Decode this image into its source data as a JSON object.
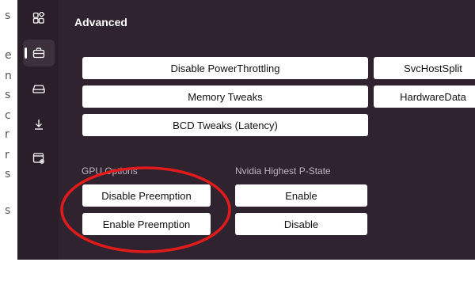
{
  "left_strip": {
    "chars": [
      "s",
      "e",
      "n",
      "s",
      "c",
      "r",
      "r",
      "s",
      "s"
    ]
  },
  "sidebar": {
    "items": [
      {
        "name": "grid-plus-icon"
      },
      {
        "name": "briefcase-icon",
        "active": true
      },
      {
        "name": "drive-icon"
      },
      {
        "name": "download-icon"
      },
      {
        "name": "window-settings-icon"
      }
    ]
  },
  "header": {
    "title": "Advanced"
  },
  "tweaks": {
    "col1": [
      "Disable PowerThrottling",
      "Memory Tweaks",
      "BCD Tweaks (Latency)"
    ],
    "col2": [
      "SvcHostSplit",
      "HardwareData"
    ]
  },
  "gpu": {
    "label": "GPU Options",
    "buttons": [
      "Disable Preemption",
      "Enable Preemption"
    ]
  },
  "nvidia": {
    "label": "Nvidia Highest P-State",
    "buttons": [
      "Enable",
      "Disable"
    ]
  },
  "colors": {
    "annotation": "#e01b1b",
    "app_bg": "#2b1f2b",
    "panel_bg": "#302330",
    "button_bg": "#ffffff"
  }
}
